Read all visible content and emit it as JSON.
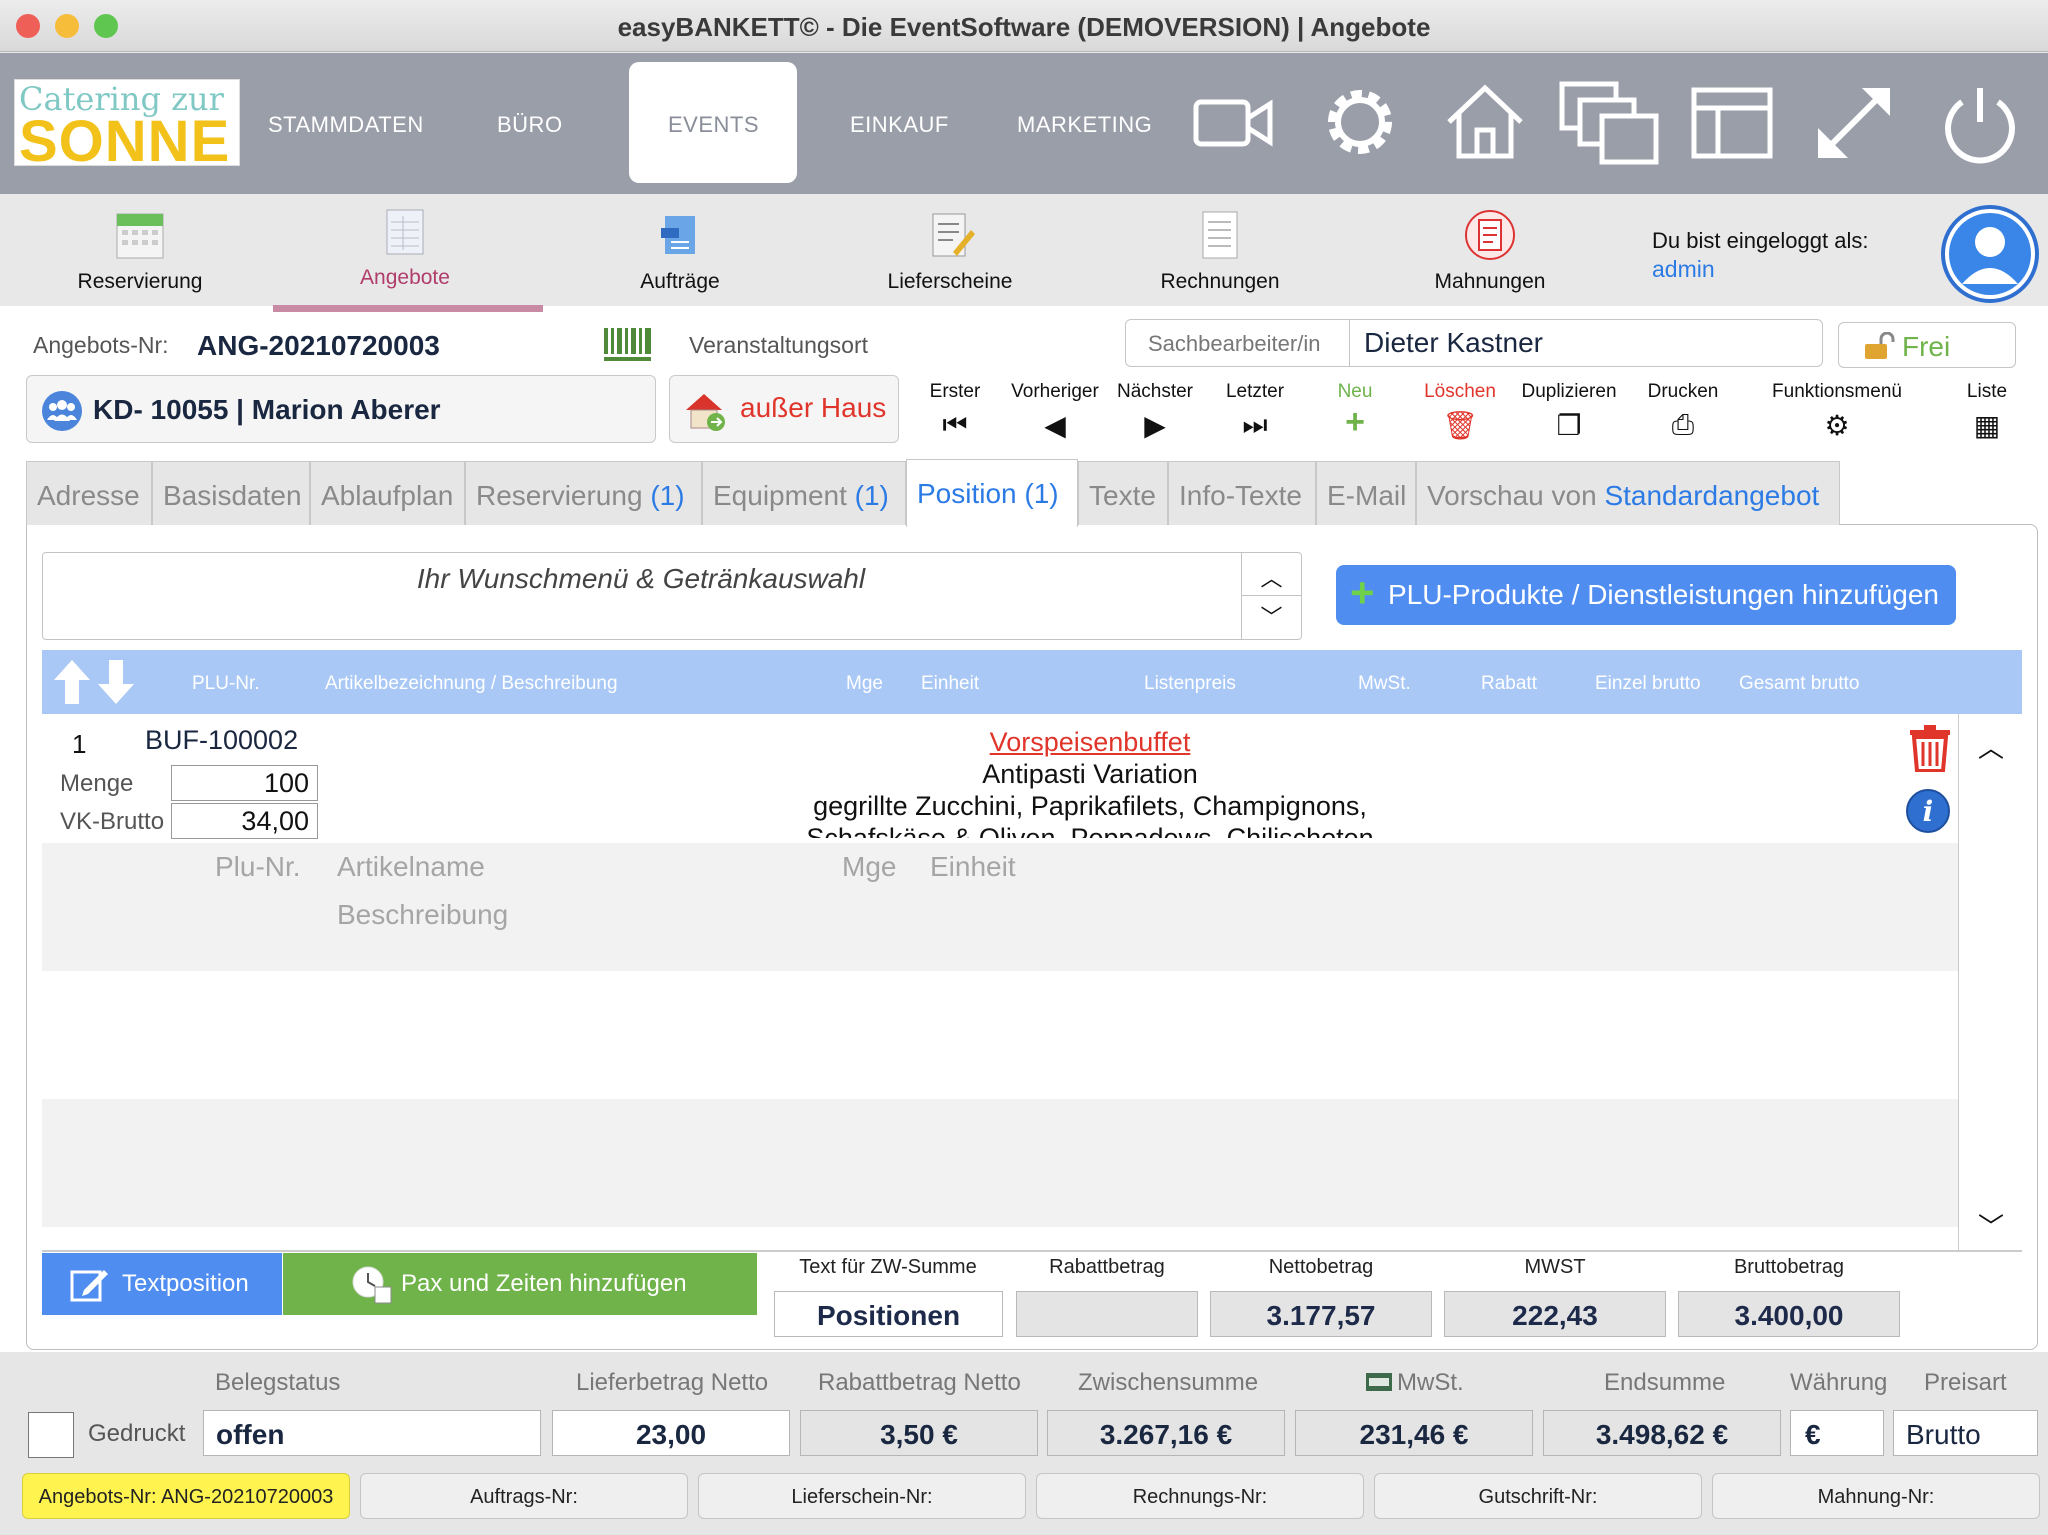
{
  "window": {
    "title": "easyBANKETT© - Die EventSoftware (DEMOVERSION) | Angebote"
  },
  "logo": {
    "line1": "Catering zur",
    "line2": "SONNE"
  },
  "topnav": {
    "items": [
      "STAMMDATEN",
      "BÜRO",
      "EVENTS",
      "EINKAUF",
      "MARKETING"
    ],
    "active": "EVENTS",
    "icons": [
      "video-icon",
      "gear-icon",
      "home-icon",
      "windows-icon",
      "layout-icon",
      "fullscreen-icon",
      "power-icon"
    ]
  },
  "subnav": {
    "items": [
      "Reservierung",
      "Angebote",
      "Aufträge",
      "Lieferscheine",
      "Rechnungen",
      "Mahnungen"
    ],
    "active": "Angebote",
    "login_label": "Du bist eingeloggt als:",
    "user": "admin"
  },
  "header": {
    "angebot_label": "Angebots-Nr:",
    "angebot_nr": "ANG-20210720003",
    "ort_label": "Veranstaltungsort",
    "sachbearbeiter_label": "Sachbearbeiter/in",
    "sachbearbeiter": "Dieter Kastner",
    "status": "Frei",
    "kunde": "KD- 10055 | Marion Aberer",
    "ort": "außer Haus"
  },
  "record_nav": {
    "erster": "Erster",
    "vorheriger": "Vorheriger",
    "naechster": "Nächster",
    "letzter": "Letzter",
    "neu": "Neu",
    "loeschen": "Löschen",
    "duplizieren": "Duplizieren",
    "drucken": "Drucken",
    "funktionsmenue": "Funktionsmenü",
    "liste": "Liste"
  },
  "tabs": [
    {
      "label": "Adresse",
      "count": ""
    },
    {
      "label": "Basisdaten",
      "count": ""
    },
    {
      "label": "Ablaufplan",
      "count": ""
    },
    {
      "label": "Reservierung",
      "count": "(1)"
    },
    {
      "label": "Equipment",
      "count": "(1)"
    },
    {
      "label": "Position (1)",
      "count": ""
    },
    {
      "label": "Texte",
      "count": ""
    },
    {
      "label": "Info-Texte",
      "count": ""
    },
    {
      "label": "E-Mail",
      "count": ""
    },
    {
      "label": "Vorschau von",
      "count": "Standardangebot"
    }
  ],
  "position": {
    "menu_title": "Ihr Wunschmenü & Getränkauswahl",
    "add_button": "PLU-Produkte / Dienstleistungen hinzufügen",
    "columns": [
      "PLU-Nr.",
      "Artikelbezeichnung / Beschreibung",
      "Mge",
      "Einheit",
      "Listenpreis",
      "MwSt.",
      "Rabatt",
      "Einzel brutto",
      "Gesamt brutto"
    ],
    "rows": [
      {
        "pos": "1",
        "plu": "BUF-100002",
        "menge_label": "Menge",
        "menge": "100",
        "vk_label": "VK-Brutto",
        "vk": "34,00",
        "title": "Vorspeisenbuffet",
        "desc1": "Antipasti Variation",
        "desc2": "gegrillte Zucchini, Paprikafilets, Champignons,",
        "desc3": "Schafskäse & Oliven, Peppadews, Chilischoten"
      }
    ],
    "new_row": {
      "plu": "Plu-Nr.",
      "name": "Artikelname",
      "mge": "Mge",
      "einheit": "Einheit",
      "beschreibung": "Beschreibung"
    },
    "textposition_btn": "Textposition",
    "pax_btn": "Pax und Zeiten hinzufügen",
    "summary": {
      "zw_label": "Text für ZW-Summe",
      "zw": "Positionen",
      "rabatt_label": "Rabattbetrag",
      "rabatt": "",
      "netto_label": "Nettobetrag",
      "netto": "3.177,57",
      "mwst_label": "MWST",
      "mwst": "222,43",
      "brutto_label": "Bruttobetrag",
      "brutto": "3.400,00"
    }
  },
  "footer": {
    "belegstatus_label": "Belegstatus",
    "gedruckt_label": "Gedruckt",
    "belegstatus": "offen",
    "lieferbetrag_label": "Lieferbetrag Netto",
    "lieferbetrag": "23,00",
    "rabattbetrag_label": "Rabattbetrag Netto",
    "rabattbetrag": "3,50 €",
    "zwischensumme_label": "Zwischensumme",
    "zwischensumme": "3.267,16 €",
    "mwst_label": "MwSt.",
    "mwst": "231,46 €",
    "endsumme_label": "Endsumme",
    "endsumme": "3.498,62 €",
    "waehrung_label": "Währung",
    "waehrung": "€",
    "preisart_label": "Preisart",
    "preisart": "Brutto"
  },
  "refs": [
    "Angebots-Nr: ANG-20210720003",
    "Auftrags-Nr:",
    "Lieferschein-Nr:",
    "Rechnungs-Nr:",
    "Gutschrift-Nr:",
    "Mahnung-Nr:"
  ],
  "colors": {
    "nav_bg": "#9a9ea9",
    "accent_blue": "#4f8df0",
    "green": "#6fb34a",
    "red": "#e0352b",
    "yellow": "#fff44f"
  }
}
